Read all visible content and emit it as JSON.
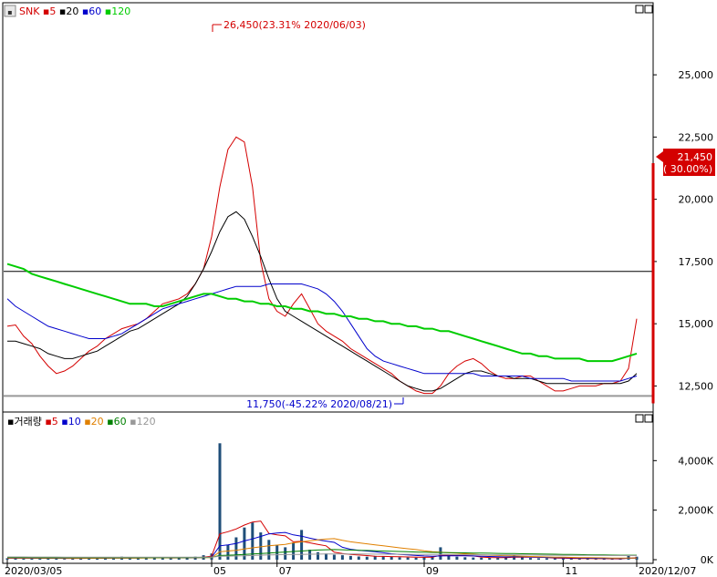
{
  "legend_price": {
    "symbol": "SNK",
    "items": [
      {
        "label": "5",
        "color": "#d40000"
      },
      {
        "label": "20",
        "color": "#000000"
      },
      {
        "label": "60",
        "color": "#0000cc"
      },
      {
        "label": "120",
        "color": "#00cc00"
      }
    ]
  },
  "legend_volume": {
    "label": "거래량",
    "items": [
      {
        "label": "5",
        "color": "#d40000"
      },
      {
        "label": "10",
        "color": "#0000cc"
      },
      {
        "label": "20",
        "color": "#e08000"
      },
      {
        "label": "60",
        "color": "#008000"
      },
      {
        "label": "120",
        "color": "#999999"
      }
    ]
  },
  "annotations": {
    "high": "26,450(23.31% 2020/06/03)",
    "low": "11,750(-45.22% 2020/08/21)",
    "current_price": "21,450",
    "current_change": "( 30.00%)"
  },
  "chart_data": [
    {
      "type": "candlestick",
      "title": "SNK",
      "ylim": [
        11600,
        27200
      ],
      "y_ticks": [
        12500,
        15000,
        17500,
        20000,
        22500,
        25000
      ],
      "y_tick_labels": [
        "12,500",
        "15,000",
        "17,500",
        "20,000",
        "22,500",
        "25,000"
      ],
      "reference_levels": [
        17100,
        12100
      ],
      "series": [
        {
          "name": "5",
          "color": "#d40000",
          "values": [
            14900,
            14950,
            14500,
            14200,
            13700,
            13300,
            13000,
            13100,
            13300,
            13600,
            13900,
            14100,
            14400,
            14600,
            14800,
            14900,
            15000,
            15200,
            15500,
            15800,
            15900,
            16000,
            16200,
            16600,
            17200,
            18500,
            20500,
            22000,
            22500,
            22300,
            20500,
            17500,
            16000,
            15500,
            15300,
            15800,
            16200,
            15600,
            15000,
            14700,
            14500,
            14300,
            14000,
            13800,
            13600,
            13400,
            13200,
            13000,
            12700,
            12500,
            12300,
            12200,
            12200,
            12500,
            13000,
            13300,
            13500,
            13600,
            13400,
            13100,
            12900,
            12800,
            12800,
            12900,
            12900,
            12700,
            12500,
            12300,
            12300,
            12400,
            12500,
            12500,
            12500,
            12600,
            12600,
            12700,
            13200,
            15200
          ]
        },
        {
          "name": "20",
          "color": "#000000",
          "values": [
            14300,
            14300,
            14200,
            14100,
            14000,
            13800,
            13700,
            13600,
            13600,
            13700,
            13800,
            13900,
            14100,
            14300,
            14500,
            14700,
            14800,
            15000,
            15200,
            15400,
            15600,
            15800,
            16100,
            16600,
            17200,
            17900,
            18700,
            19300,
            19500,
            19200,
            18500,
            17700,
            16800,
            16000,
            15500,
            15300,
            15100,
            14900,
            14700,
            14500,
            14300,
            14100,
            13900,
            13700,
            13500,
            13300,
            13100,
            12900,
            12700,
            12500,
            12400,
            12300,
            12300,
            12400,
            12600,
            12800,
            13000,
            13100,
            13100,
            13000,
            12900,
            12900,
            12800,
            12800,
            12800,
            12700,
            12600,
            12600,
            12600,
            12600,
            12600,
            12600,
            12600,
            12600,
            12600,
            12600,
            12700,
            13000
          ]
        },
        {
          "name": "60",
          "color": "#0000cc",
          "values": [
            16000,
            15700,
            15500,
            15300,
            15100,
            14900,
            14800,
            14700,
            14600,
            14500,
            14400,
            14400,
            14400,
            14500,
            14600,
            14800,
            15000,
            15200,
            15400,
            15600,
            15700,
            15800,
            15900,
            16000,
            16100,
            16200,
            16300,
            16400,
            16500,
            16500,
            16500,
            16500,
            16600,
            16600,
            16600,
            16600,
            16600,
            16500,
            16400,
            16200,
            15900,
            15500,
            15000,
            14500,
            14000,
            13700,
            13500,
            13400,
            13300,
            13200,
            13100,
            13000,
            13000,
            13000,
            13000,
            13000,
            13000,
            13000,
            12900,
            12900,
            12900,
            12900,
            12900,
            12900,
            12800,
            12800,
            12800,
            12800,
            12800,
            12700,
            12700,
            12700,
            12700,
            12700,
            12700,
            12700,
            12800,
            12900
          ]
        },
        {
          "name": "120",
          "color": "#00cc00",
          "values": [
            17400,
            17300,
            17200,
            17000,
            16900,
            16800,
            16700,
            16600,
            16500,
            16400,
            16300,
            16200,
            16100,
            16000,
            15900,
            15800,
            15800,
            15800,
            15700,
            15700,
            15800,
            15900,
            16000,
            16100,
            16200,
            16200,
            16100,
            16000,
            16000,
            15900,
            15900,
            15800,
            15800,
            15700,
            15700,
            15600,
            15600,
            15500,
            15500,
            15400,
            15400,
            15300,
            15300,
            15200,
            15200,
            15100,
            15100,
            15000,
            15000,
            14900,
            14900,
            14800,
            14800,
            14700,
            14700,
            14600,
            14500,
            14400,
            14300,
            14200,
            14100,
            14000,
            13900,
            13800,
            13800,
            13700,
            13700,
            13600,
            13600,
            13600,
            13600,
            13500,
            13500,
            13500,
            13500,
            13600,
            13700,
            13800
          ]
        }
      ]
    },
    {
      "type": "bar",
      "title": "거래량",
      "ylim": [
        0,
        5300
      ],
      "y_ticks": [
        0,
        2000,
        4000
      ],
      "y_tick_labels": [
        "0K",
        "2,000K",
        "4,000K"
      ],
      "values": [
        60,
        50,
        40,
        60,
        80,
        50,
        40,
        30,
        40,
        60,
        80,
        60,
        70,
        90,
        120,
        80,
        60,
        90,
        100,
        60,
        50,
        70,
        90,
        120,
        180,
        250,
        4700,
        600,
        900,
        1300,
        1500,
        1100,
        800,
        600,
        500,
        700,
        1200,
        400,
        300,
        250,
        200,
        180,
        150,
        130,
        120,
        150,
        130,
        110,
        100,
        90,
        80,
        100,
        120,
        500,
        150,
        120,
        100,
        90,
        80,
        70,
        70,
        80,
        200,
        100,
        70,
        60,
        60,
        50,
        50,
        40,
        40,
        40,
        30,
        40,
        40,
        30,
        150,
        120
      ],
      "series": [
        {
          "name": "5",
          "color": "#d40000",
          "values": [
            60,
            60,
            58,
            55,
            56,
            58,
            56,
            52,
            50,
            52,
            55,
            60,
            66,
            72,
            80,
            84,
            86,
            88,
            86,
            80,
            70,
            72,
            76,
            80,
            102,
            142,
            1040,
            1130,
            1240,
            1400,
            1520,
            1560,
            1060,
            1000,
            960,
            720,
            740,
            680,
            620,
            560,
            300,
            250,
            210,
            186,
            164,
            140,
            132,
            126,
            118,
            110,
            102,
            96,
            98,
            178,
            188,
            178,
            166,
            152,
            108,
            90,
            86,
            82,
            102,
            108,
            104,
            96,
            88,
            68,
            58,
            52,
            48,
            46,
            42,
            40,
            38,
            34,
            58,
            76
          ]
        },
        {
          "name": "10",
          "color": "#0000cc",
          "values": [
            70,
            68,
            64,
            60,
            58,
            58,
            57,
            56,
            56,
            56,
            57,
            58,
            60,
            62,
            66,
            68,
            70,
            72,
            76,
            78,
            80,
            80,
            82,
            85,
            90,
            100,
            560,
            600,
            650,
            760,
            840,
            940,
            1040,
            1080,
            1100,
            1000,
            950,
            870,
            800,
            750,
            700,
            500,
            420,
            380,
            350,
            320,
            280,
            240,
            210,
            190,
            170,
            150,
            140,
            150,
            160,
            160,
            156,
            150,
            140,
            130,
            120,
            110,
            120,
            120,
            110,
            100,
            90,
            84,
            78,
            72,
            66,
            60,
            55,
            52,
            50,
            46,
            54,
            60
          ]
        },
        {
          "name": "20",
          "color": "#e08000",
          "values": [
            72,
            72,
            70,
            70,
            68,
            66,
            64,
            62,
            60,
            60,
            60,
            60,
            62,
            64,
            66,
            66,
            68,
            70,
            72,
            74,
            76,
            78,
            80,
            80,
            82,
            86,
            320,
            350,
            380,
            430,
            480,
            520,
            560,
            590,
            620,
            680,
            720,
            760,
            800,
            830,
            850,
            780,
            720,
            680,
            640,
            600,
            560,
            520,
            480,
            440,
            410,
            360,
            320,
            300,
            280,
            260,
            240,
            220,
            200,
            180,
            170,
            160,
            150,
            140,
            130,
            120,
            110,
            104,
            98,
            92,
            86,
            80,
            76,
            72,
            68,
            64,
            64,
            66
          ]
        },
        {
          "name": "60",
          "color": "#008000",
          "values": [
            90,
            90,
            88,
            88,
            86,
            86,
            84,
            84,
            82,
            82,
            80,
            80,
            80,
            80,
            80,
            80,
            80,
            80,
            80,
            80,
            82,
            84,
            86,
            88,
            90,
            92,
            170,
            180,
            190,
            210,
            230,
            250,
            270,
            290,
            310,
            330,
            350,
            370,
            390,
            400,
            410,
            400,
            390,
            380,
            370,
            360,
            350,
            340,
            330,
            320,
            310,
            300,
            295,
            290,
            285,
            280,
            275,
            270,
            265,
            260,
            255,
            250,
            245,
            240,
            235,
            230,
            225,
            220,
            215,
            210,
            205,
            200,
            195,
            190,
            185,
            180,
            180,
            180
          ]
        },
        {
          "name": "120",
          "color": "#999999",
          "values": [
            110,
            110,
            110,
            108,
            108,
            106,
            106,
            104,
            104,
            102,
            102,
            100,
            100,
            100,
            100,
            100,
            100,
            100,
            100,
            100,
            100,
            100,
            100,
            100,
            100,
            100,
            140,
            145,
            150,
            160,
            170,
            180,
            190,
            200,
            205,
            210,
            215,
            220,
            225,
            228,
            230,
            230,
            230,
            228,
            226,
            224,
            222,
            220,
            218,
            216,
            214,
            212,
            210,
            208,
            206,
            204,
            202,
            200,
            198,
            196,
            194,
            192,
            190,
            188,
            186,
            184,
            182,
            180,
            178,
            176,
            174,
            172,
            170,
            168,
            166,
            164,
            164,
            164
          ]
        }
      ]
    }
  ],
  "x_axis": {
    "labels": [
      {
        "text": "2020/03/05",
        "index": 0
      },
      {
        "text": "05",
        "index": 25
      },
      {
        "text": "07",
        "index": 33
      },
      {
        "text": "09",
        "index": 51
      },
      {
        "text": "11",
        "index": 68
      },
      {
        "text": "2020/12/07",
        "index": 77
      }
    ]
  },
  "colors": {
    "up": "#d40000",
    "down": "#0000cc",
    "ref": "#000000",
    "grid": "#cccccc",
    "floor": "#999999"
  }
}
